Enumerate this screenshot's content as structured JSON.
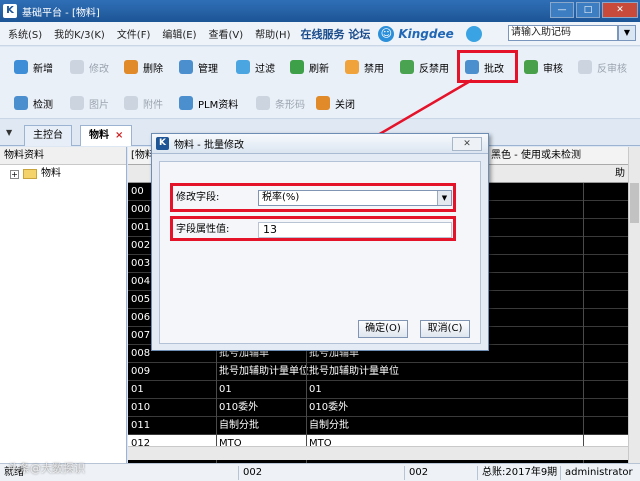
{
  "window": {
    "title": "基础平台 - [物料]",
    "app_icon_label": "K",
    "buttons": [
      "—",
      "□",
      "✕"
    ]
  },
  "menubar": {
    "items": [
      "系统(S)",
      "我的K/3(K)",
      "文件(F)",
      "编辑(E)",
      "查看(V)",
      "帮助(H)"
    ],
    "links": "在线服务 论坛",
    "brand": "Kingdee",
    "assist_placeholder": "请输入助记码",
    "assist_button": "▼"
  },
  "toolbar1": {
    "buttons": [
      {
        "label": "新增",
        "icon": "add-icon",
        "color": "#3d8ed6",
        "disabled": false
      },
      {
        "label": "修改",
        "icon": "edit-icon",
        "color": "#a9b4c0",
        "disabled": true
      },
      {
        "label": "删除",
        "icon": "delete-icon",
        "color": "#e08a2a",
        "disabled": false
      },
      {
        "label": "管理",
        "icon": "manage-icon",
        "color": "#4c8fcf",
        "disabled": false
      },
      {
        "label": "过滤",
        "icon": "filter-icon",
        "color": "#4aa5e0",
        "disabled": false
      },
      {
        "label": "刷新",
        "icon": "refresh-icon",
        "color": "#3fa04a",
        "disabled": false
      },
      {
        "label": "禁用",
        "icon": "disable-icon",
        "color": "#f0a33a",
        "disabled": false
      },
      {
        "label": "反禁用",
        "icon": "enable-icon",
        "color": "#4aa350",
        "disabled": false
      },
      {
        "label": "批改",
        "icon": "batch-edit-icon",
        "color": "#4c8fcf",
        "disabled": false
      },
      {
        "label": "审核",
        "icon": "audit-icon",
        "color": "#48a04a",
        "disabled": false
      },
      {
        "label": "反审核",
        "icon": "unaudit-icon",
        "color": "#a9b4c0",
        "disabled": true
      }
    ]
  },
  "toolbar2": {
    "buttons": [
      {
        "label": "检测",
        "icon": "check-icon",
        "color": "#4c8fcf",
        "disabled": false
      },
      {
        "label": "图片",
        "icon": "image-icon",
        "color": "#a9b4c0",
        "disabled": true
      },
      {
        "label": "附件",
        "icon": "attachment-icon",
        "color": "#a9b4c0",
        "disabled": true
      },
      {
        "label": "PLM资料",
        "icon": "plm-icon",
        "color": "#4c8fcf",
        "disabled": false
      },
      {
        "label": "条形码",
        "icon": "barcode-icon",
        "color": "#a9b4c0",
        "disabled": true
      },
      {
        "label": "关闭",
        "icon": "close-icon",
        "color": "#e08a2a",
        "disabled": false
      }
    ]
  },
  "tabs": [
    {
      "label": "主控台",
      "active": false
    },
    {
      "label": "物料",
      "active": true,
      "close": "×"
    }
  ],
  "tree": {
    "header": "物料资料",
    "root": {
      "expander": "+",
      "label": "物料"
    }
  },
  "grid": {
    "top_left": "[物料",
    "top_right": "黑色 - 使用或未检测",
    "head_right": "助",
    "rows": [
      {
        "code": "00",
        "name": "",
        "spec": "",
        "white": false
      },
      {
        "code": "000",
        "name": "",
        "spec": "",
        "white": false
      },
      {
        "code": "001",
        "name": "",
        "spec": "",
        "white": false
      },
      {
        "code": "002",
        "name": "",
        "spec": "",
        "white": false
      },
      {
        "code": "003",
        "name": "",
        "spec": "",
        "white": false
      },
      {
        "code": "004",
        "name": "",
        "spec": "",
        "white": false
      },
      {
        "code": "005",
        "name": "",
        "spec": "",
        "white": false
      },
      {
        "code": "006",
        "name": "",
        "spec": "",
        "white": false
      },
      {
        "code": "007",
        "name": "",
        "spec": "",
        "white": false
      },
      {
        "code": "008",
        "name": "批号加辅单",
        "spec": "批号加辅单",
        "white": false
      },
      {
        "code": "009",
        "name": "批号加辅助计量单位",
        "spec": "批号加辅助计量单位",
        "white": false
      },
      {
        "code": "01",
        "name": "01",
        "spec": "01",
        "white": false
      },
      {
        "code": "010",
        "name": "010委外",
        "spec": "010委外",
        "white": false
      },
      {
        "code": "011",
        "name": "自制分批",
        "spec": "自制分批",
        "white": false
      },
      {
        "code": "012",
        "name": "MTO",
        "spec": "MTO",
        "white": true
      }
    ]
  },
  "statusbar": {
    "cells": [
      "就绪",
      "002",
      "002",
      "总账:2017年9期",
      "administrator"
    ]
  },
  "dialog": {
    "icon_label": "K",
    "title": "物料 - 批量修改",
    "close": "✕",
    "field_label": "修改字段:",
    "field_value": "税率(%)",
    "value_label": "字段属性值:",
    "value": "13",
    "ok": "确定(O)",
    "cancel": "取消(C)"
  },
  "watermark": "头条@大数探识",
  "colors": {
    "highlight": "#e4132a",
    "titlebar": "#1d5596",
    "grid_bg": "#000000"
  }
}
